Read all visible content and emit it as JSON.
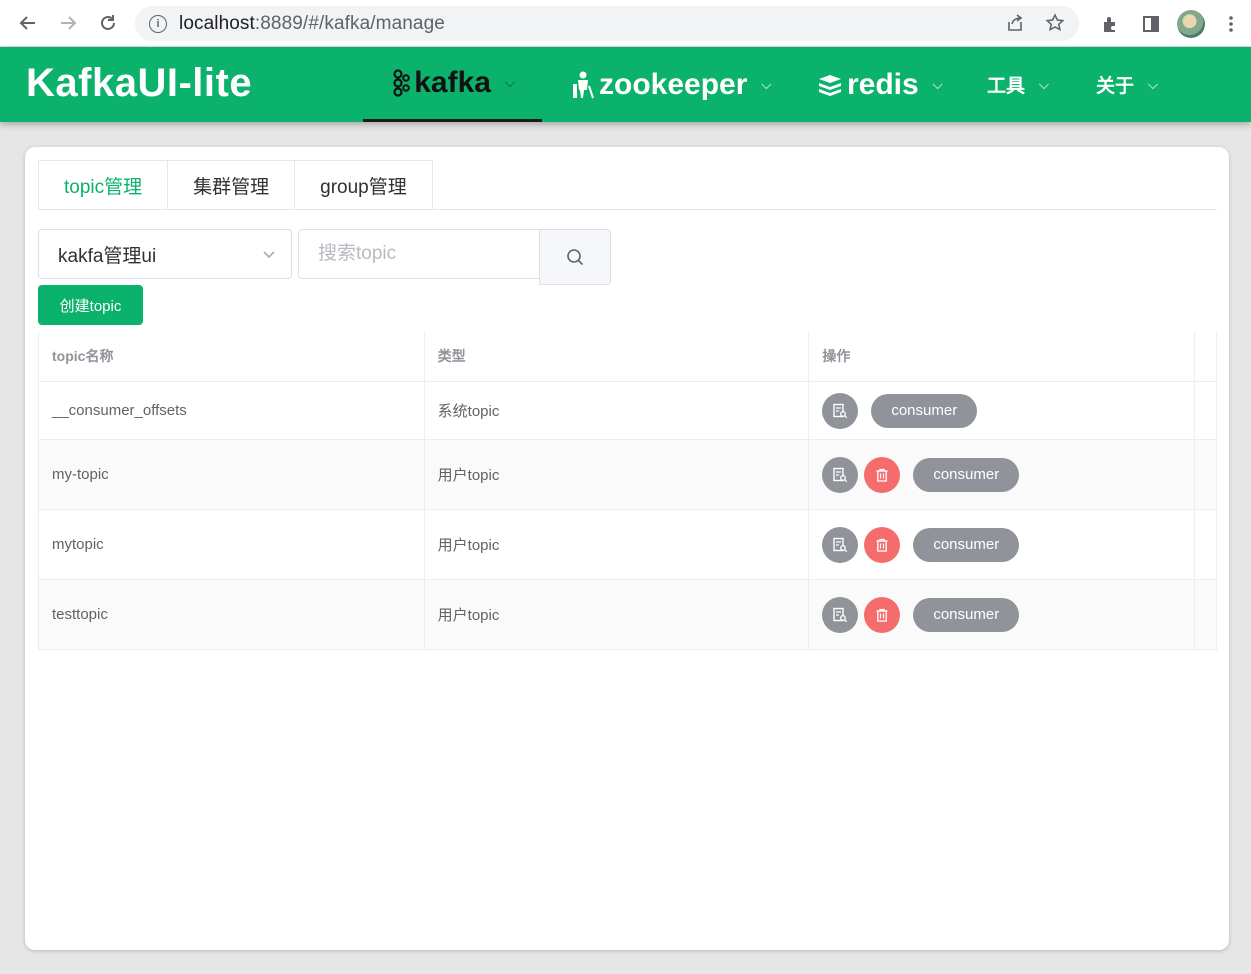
{
  "browser": {
    "url_host": "localhost",
    "url_rest": ":8889/#/kafka/manage"
  },
  "app": {
    "logo": "KafkaUI-lite",
    "menu": [
      {
        "label": "kafka"
      },
      {
        "label": "zookeeper"
      },
      {
        "label": "redis"
      },
      {
        "label": "工具"
      },
      {
        "label": "关于"
      }
    ]
  },
  "tabs": [
    {
      "label": "topic管理",
      "active": true
    },
    {
      "label": "集群管理"
    },
    {
      "label": "group管理"
    }
  ],
  "cluster_select": {
    "value": "kakfa管理ui"
  },
  "search": {
    "placeholder": "搜索topic",
    "value": ""
  },
  "create_button": "创建topic",
  "table": {
    "headers": [
      "topic名称",
      "类型",
      "操作"
    ],
    "rows": [
      {
        "name": "__consumer_offsets",
        "type": "系统topic",
        "consumer_label": "consumer",
        "deletable": false
      },
      {
        "name": "my-topic",
        "type": "用户topic",
        "consumer_label": "consumer",
        "deletable": true
      },
      {
        "name": "mytopic",
        "type": "用户topic",
        "consumer_label": "consumer",
        "deletable": true
      },
      {
        "name": "testtopic",
        "type": "用户topic",
        "consumer_label": "consumer",
        "deletable": true
      }
    ]
  },
  "colors": {
    "brand": "#0bb26b",
    "info": "#909399",
    "danger": "#f56c6c"
  }
}
